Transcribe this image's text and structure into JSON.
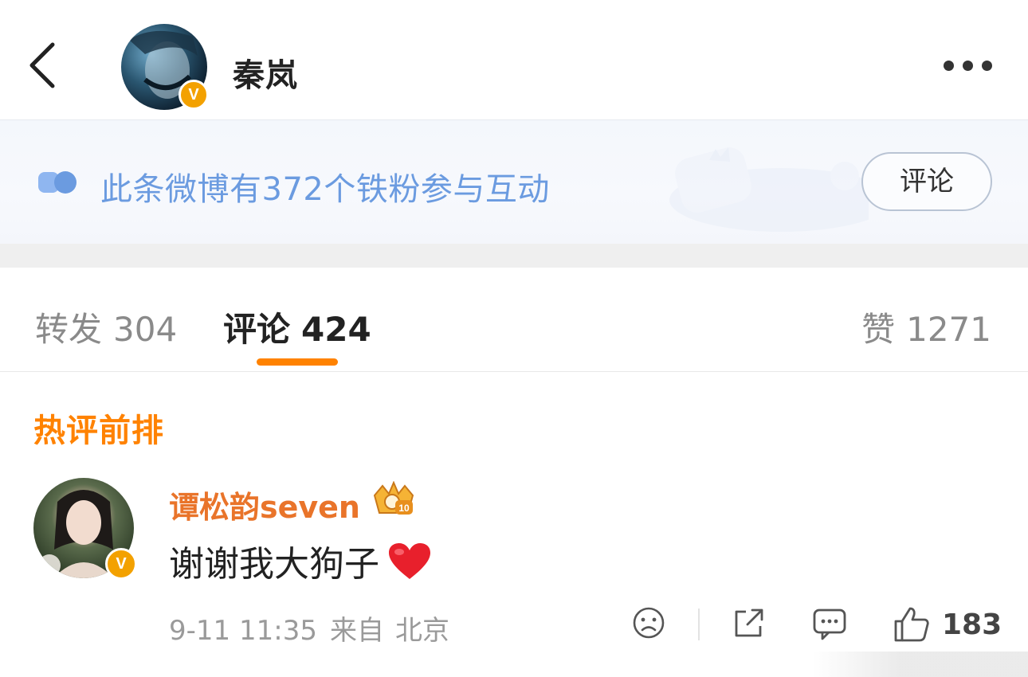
{
  "header": {
    "username": "秦岚",
    "verified_badge": "V",
    "back_icon": "chevron-left-icon",
    "more_icon": "more-horizontal-icon"
  },
  "banner": {
    "text": "此条微博有372个铁粉参与互动",
    "button_label": "评论",
    "icon": "fans-icon",
    "text_color": "#6b9be0"
  },
  "tabs": [
    {
      "label": "转发",
      "count": "304",
      "active": false
    },
    {
      "label": "评论",
      "count": "424",
      "active": true
    },
    {
      "label": "赞",
      "count": "1271",
      "active": false
    }
  ],
  "section": {
    "title": "热评前排"
  },
  "comments": [
    {
      "author": "谭松韵seven",
      "verified_badge": "V",
      "badge_icon": "fan-crown-icon",
      "badge_level": "10",
      "text": "谢谢我大狗子",
      "emoji": "heart-icon",
      "time": "9-11 11:35",
      "source": "来自",
      "location": "北京",
      "likes": "183"
    }
  ],
  "colors": {
    "accent": "#ff8200",
    "author": "#e9742a",
    "verified": "#f3a100"
  }
}
